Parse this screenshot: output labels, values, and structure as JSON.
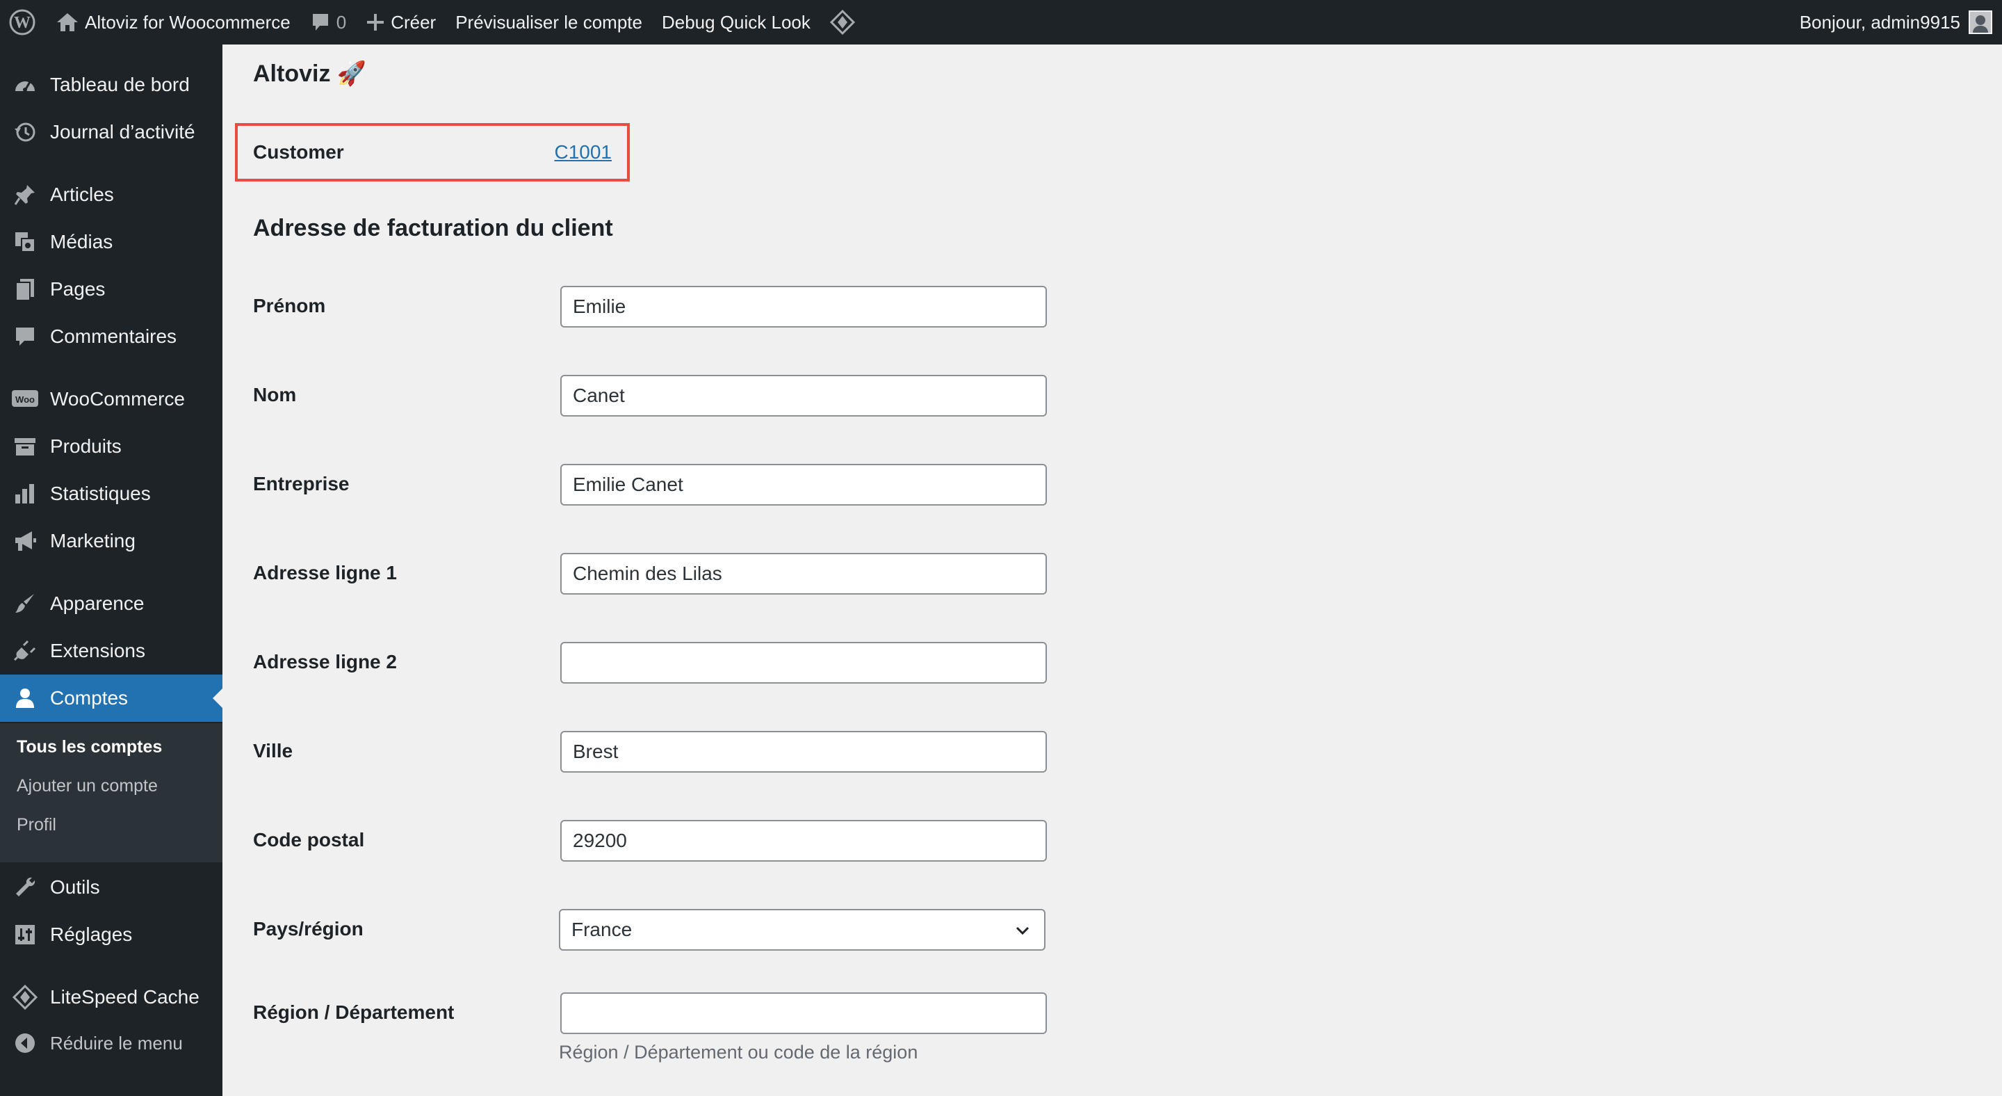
{
  "adminbar": {
    "site_name": "Altoviz for Woocommerce",
    "comment_count": "0",
    "new_label": "Créer",
    "preview_label": "Prévisualiser le compte",
    "debug_label": "Debug Quick Look",
    "greeting": "Bonjour, admin9915"
  },
  "sidebar": {
    "items": [
      {
        "label": "Tableau de bord",
        "icon": "dashboard-icon"
      },
      {
        "label": "Journal d’activité",
        "icon": "history-icon"
      },
      {
        "label": "Articles",
        "icon": "pin-icon"
      },
      {
        "label": "Médias",
        "icon": "media-icon"
      },
      {
        "label": "Pages",
        "icon": "pages-icon"
      },
      {
        "label": "Commentaires",
        "icon": "comment-icon"
      },
      {
        "label": "WooCommerce",
        "icon": "woo-icon"
      },
      {
        "label": "Produits",
        "icon": "archive-icon"
      },
      {
        "label": "Statistiques",
        "icon": "bar-chart-icon"
      },
      {
        "label": "Marketing",
        "icon": "megaphone-icon"
      },
      {
        "label": "Apparence",
        "icon": "brush-icon"
      },
      {
        "label": "Extensions",
        "icon": "plugin-icon"
      },
      {
        "label": "Comptes",
        "icon": "user-icon",
        "current": true
      },
      {
        "label": "Outils",
        "icon": "wrench-icon"
      },
      {
        "label": "Réglages",
        "icon": "settings-icon"
      },
      {
        "label": "LiteSpeed Cache",
        "icon": "litespeed-icon"
      }
    ],
    "submenu": [
      {
        "label": "Tous les comptes",
        "current": true
      },
      {
        "label": "Ajouter un compte"
      },
      {
        "label": "Profil"
      }
    ],
    "collapse_label": "Réduire le menu"
  },
  "main": {
    "title": "Altoviz 🚀",
    "customer_label": "Customer",
    "customer_id": "C1001",
    "section_title": "Adresse de facturation du client",
    "fields": [
      {
        "label": "Prénom",
        "value": "Emilie"
      },
      {
        "label": "Nom",
        "value": "Canet"
      },
      {
        "label": "Entreprise",
        "value": "Emilie Canet"
      },
      {
        "label": "Adresse ligne 1",
        "value": "Chemin des Lilas"
      },
      {
        "label": "Adresse ligne 2",
        "value": ""
      },
      {
        "label": "Ville",
        "value": "Brest"
      },
      {
        "label": "Code postal",
        "value": "29200"
      }
    ],
    "country_label": "Pays/région",
    "country_value": "France",
    "region_label": "Région / Département",
    "region_value": "",
    "region_help": "Région / Département ou code de la région"
  },
  "colors": {
    "adminbar_bg": "#1d2327",
    "accent": "#2271b1",
    "highlight_border": "#e74c3c",
    "page_bg": "#f0f0f1"
  }
}
